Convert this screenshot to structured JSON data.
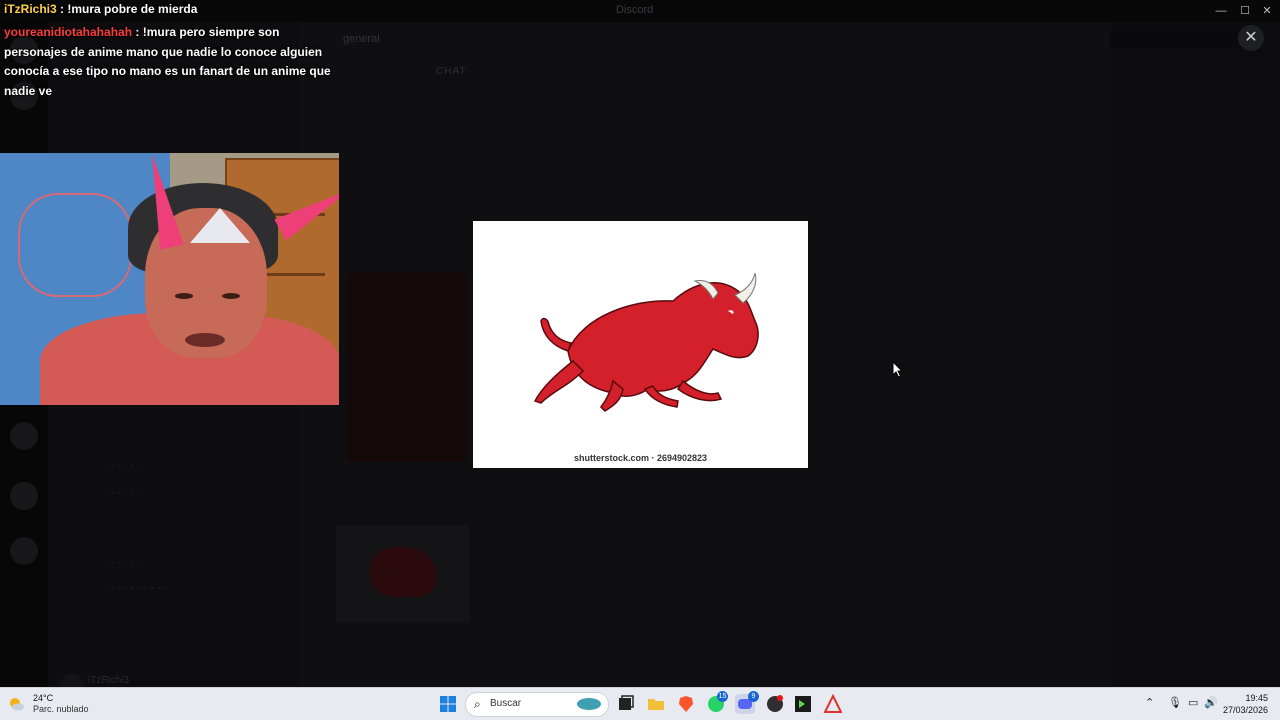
{
  "window": {
    "title": "Discord",
    "controls": [
      "—",
      "☐",
      "✕"
    ]
  },
  "stream_chat": [
    {
      "user": "iTzRichi3",
      "sep": " : ",
      "text": "!mura pobre de mierda"
    },
    {
      "user": "youreanidiotahahahah",
      "sep": " : ",
      "text": "!mura pero siempre son personajes de anime mano que nadie lo conoce alguien conocía a ese tipo no mano es un fanart de un anime que nadie ve"
    }
  ],
  "image_viewer": {
    "watermark": "shutterstock.com · 2694902823",
    "close_label": "✕"
  },
  "background": {
    "chat_title": "general",
    "tab": "CHAT",
    "members_header": "",
    "username": "iTzRichi3"
  },
  "taskbar": {
    "weather_temp": "24°C",
    "weather_cond": "Parc. nublado",
    "search_placeholder": "Buscar",
    "whatsapp_badge": "15",
    "discord_badge": "9",
    "time": "19:45",
    "date": "27/03/2026",
    "icons": [
      "windows-start-icon",
      "search-icon",
      "widgets-icon",
      "task-view-icon",
      "file-explorer-icon",
      "brave-icon",
      "whatsapp-icon",
      "discord-icon",
      "obs-icon",
      "terminal-icon",
      "app-icon"
    ]
  },
  "colors": {
    "user1": "#ffd24a",
    "user2": "#ff3b3b",
    "taskbar_bg": "#e7eaf0"
  }
}
